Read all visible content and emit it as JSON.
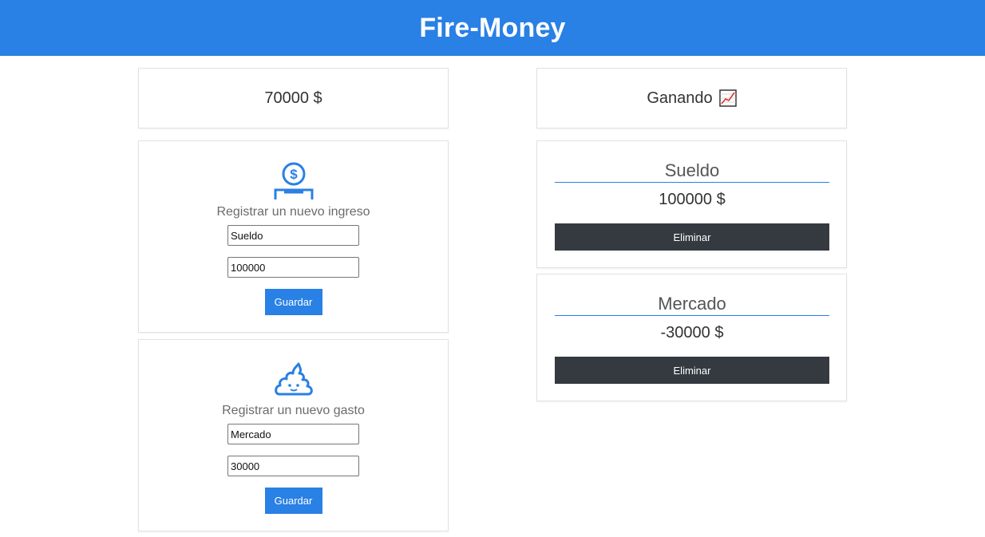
{
  "app": {
    "title": "Fire-Money",
    "accent_color": "#2980e5",
    "dark_button_color": "#343a40"
  },
  "balance": {
    "amount": "70000 $"
  },
  "status": {
    "label": "Ganando",
    "icon": "chart-increasing-icon"
  },
  "income_form": {
    "icon": "coin-deposit-icon",
    "title": "Registrar un nuevo ingreso",
    "name_value": "Sueldo",
    "amount_value": "100000",
    "save_label": "Guardar"
  },
  "expense_form": {
    "icon": "poop-icon",
    "title": "Registrar un nuevo gasto",
    "name_value": "Mercado",
    "amount_value": "30000",
    "save_label": "Guardar"
  },
  "transactions": [
    {
      "name": "Sueldo",
      "amount": "100000 $",
      "delete_label": "Eliminar"
    },
    {
      "name": "Mercado",
      "amount": "-30000 $",
      "delete_label": "Eliminar"
    }
  ]
}
